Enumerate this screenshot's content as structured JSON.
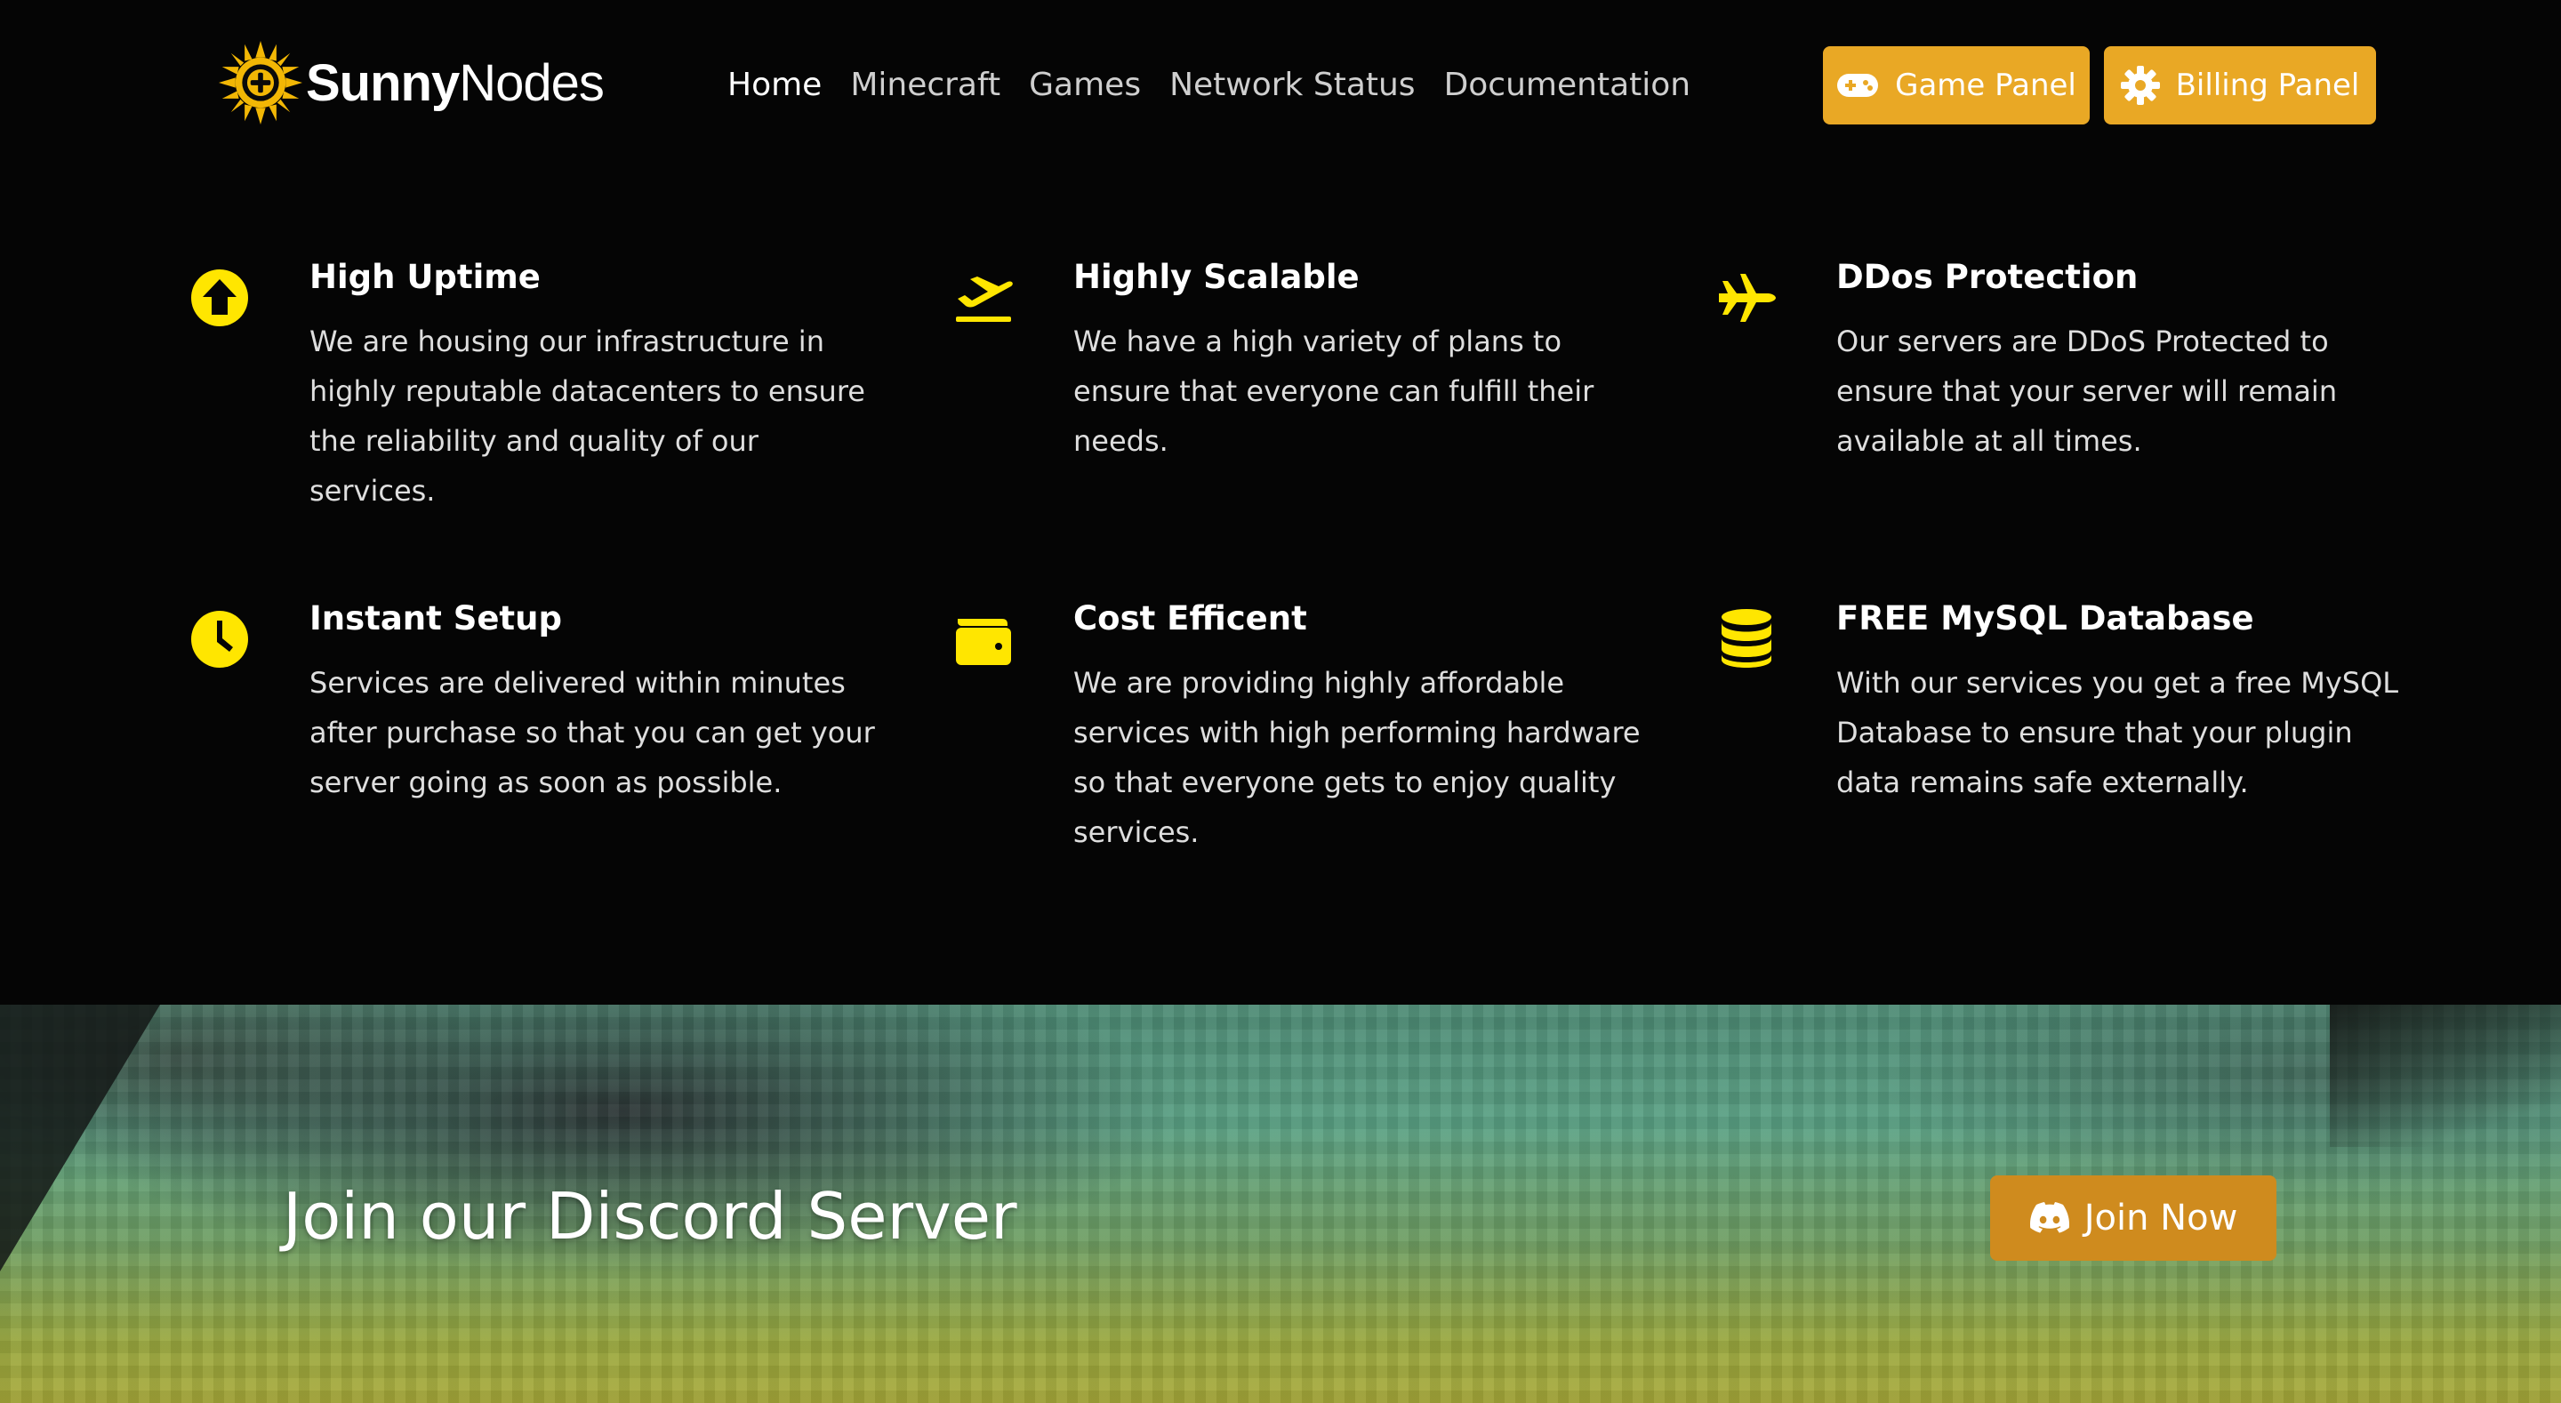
{
  "brand": {
    "name_bold": "Sunny",
    "name_light": "Nodes"
  },
  "nav": {
    "links": [
      {
        "label": "Home",
        "active": true
      },
      {
        "label": "Minecraft",
        "active": false
      },
      {
        "label": "Games",
        "active": false
      },
      {
        "label": "Network Status",
        "active": false
      },
      {
        "label": "Documentation",
        "active": false
      }
    ],
    "game_panel": {
      "label": "Game Panel",
      "icon": "gamepad-icon"
    },
    "billing_panel": {
      "label": "Billing Panel",
      "icon": "gear-icon"
    }
  },
  "features": [
    {
      "icon": "arrow-up-circle-icon",
      "title": "High Uptime",
      "description": "We are housing our infrastructure in highly reputable datacenters to ensure the reliability and quality of our services."
    },
    {
      "icon": "plane-departure-icon",
      "title": "Highly Scalable",
      "description": "We have a high variety of plans to ensure that everyone can fulfill their needs."
    },
    {
      "icon": "fighter-jet-icon",
      "title": "DDos Protection",
      "description": "Our servers are DDoS Protected to ensure that your server will remain available at all times."
    },
    {
      "icon": "clock-icon",
      "title": "Instant Setup",
      "description": "Services are delivered within minutes after purchase so that you can get your server going as soon as possible."
    },
    {
      "icon": "wallet-icon",
      "title": "Cost Efficent",
      "description": "We are providing highly affordable services with high performing hardware so that everyone gets to enjoy quality services."
    },
    {
      "icon": "database-icon",
      "title": "FREE MySQL Database",
      "description": "With our services you get a free MySQL Database to ensure that your plugin data remains safe externally."
    }
  ],
  "banner": {
    "title": "Join our Discord Server",
    "button_label": "Join Now",
    "button_icon": "discord-icon"
  },
  "colors": {
    "accent": "#e9a825",
    "icon_yellow": "#ffe600",
    "join_button": "#cf8b1e",
    "background": "#050505"
  }
}
